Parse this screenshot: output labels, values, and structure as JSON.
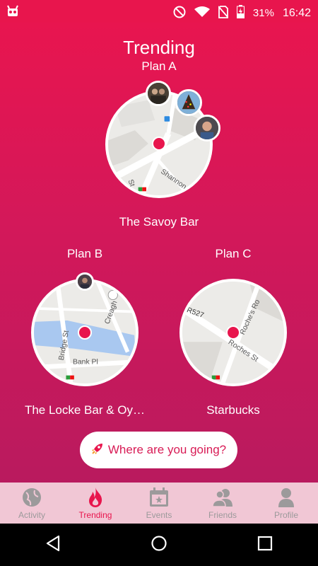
{
  "status_bar": {
    "battery_percent": "31%",
    "time": "16:42",
    "icons": [
      "android-debug-icon",
      "dnd-icon",
      "wifi-icon",
      "no-sim-icon",
      "battery-charging-icon"
    ]
  },
  "header": {
    "title": "Trending",
    "plan_a_label": "Plan A"
  },
  "plans": [
    {
      "label": "Plan A",
      "venue": "The Savoy Bar",
      "street_labels": [
        "Shannon",
        "St"
      ]
    },
    {
      "label": "Plan B",
      "venue": "The Locke Bar & Oy…",
      "street_labels": [
        "Bridge St",
        "Creagh",
        "Bank Pl"
      ]
    },
    {
      "label": "Plan C",
      "venue": "Starbucks",
      "street_labels": [
        "R527",
        "Roche's Ro",
        "Roches St"
      ]
    }
  ],
  "search": {
    "button_label": "Where are you going?",
    "icon": "rocket-icon"
  },
  "bottom_nav": {
    "items": [
      {
        "label": "Activity",
        "icon": "globe-icon"
      },
      {
        "label": "Trending",
        "icon": "flame-icon",
        "active": true
      },
      {
        "label": "Events",
        "icon": "calendar-star-icon"
      },
      {
        "label": "Friends",
        "icon": "friends-icon"
      },
      {
        "label": "Profile",
        "icon": "profile-icon"
      }
    ]
  },
  "colors": {
    "brand": "#e8154d",
    "gradient_bottom": "#b91a5e",
    "nav_background": "#f1c7d5",
    "nav_inactive": "#9c9a9b"
  }
}
